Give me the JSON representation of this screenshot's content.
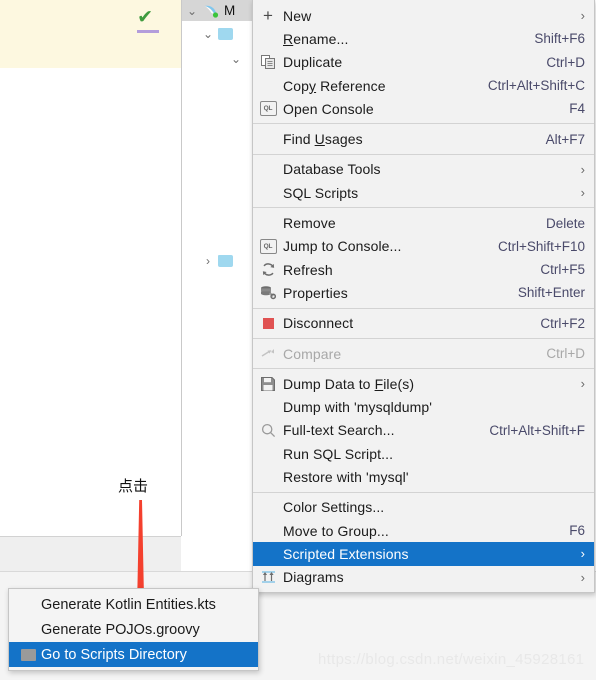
{
  "background": {
    "tree": {
      "root_label": "M",
      "root_icon": "mysql-dolphin-icon",
      "status_icon": "green-check-icon",
      "nodes": [
        {
          "chevron": "down",
          "icon": "folder-icon"
        },
        {
          "chevron": "down",
          "icon": "folder-icon"
        },
        {
          "chevron": "right",
          "icon": "folder-icon"
        }
      ]
    }
  },
  "annotation": {
    "label": "点击",
    "arrow_color": "#f4402e"
  },
  "context_menu": {
    "groups": [
      {
        "items": [
          {
            "label": "New",
            "accel": "",
            "icon": "plus-icon",
            "submenu": true,
            "disabled": false,
            "selected": false,
            "mnemonic": ""
          },
          {
            "label": "Rename...",
            "accel": "Shift+F6",
            "icon": "",
            "submenu": false,
            "disabled": false,
            "selected": false,
            "mnemonic": "R"
          },
          {
            "label": "Duplicate",
            "accel": "Ctrl+D",
            "icon": "duplicate-icon",
            "submenu": false,
            "disabled": false,
            "selected": false,
            "mnemonic": ""
          },
          {
            "label": "Copy Reference",
            "accel": "Ctrl+Alt+Shift+C",
            "icon": "",
            "submenu": false,
            "disabled": false,
            "selected": false,
            "mnemonic": "y"
          },
          {
            "label": "Open Console",
            "accel": "F4",
            "icon": "ql-console-icon",
            "submenu": false,
            "disabled": false,
            "selected": false,
            "mnemonic": ""
          }
        ]
      },
      {
        "items": [
          {
            "label": "Find Usages",
            "accel": "Alt+F7",
            "icon": "",
            "submenu": false,
            "disabled": false,
            "selected": false,
            "mnemonic": "U"
          }
        ]
      },
      {
        "items": [
          {
            "label": "Database Tools",
            "accel": "",
            "icon": "",
            "submenu": true,
            "disabled": false,
            "selected": false,
            "mnemonic": ""
          },
          {
            "label": "SQL Scripts",
            "accel": "",
            "icon": "",
            "submenu": true,
            "disabled": false,
            "selected": false,
            "mnemonic": ""
          }
        ]
      },
      {
        "items": [
          {
            "label": "Remove",
            "accel": "Delete",
            "icon": "",
            "submenu": false,
            "disabled": false,
            "selected": false,
            "mnemonic": ""
          },
          {
            "label": "Jump to Console...",
            "accel": "Ctrl+Shift+F10",
            "icon": "ql-console-icon",
            "submenu": false,
            "disabled": false,
            "selected": false,
            "mnemonic": ""
          },
          {
            "label": "Refresh",
            "accel": "Ctrl+F5",
            "icon": "refresh-icon",
            "submenu": false,
            "disabled": false,
            "selected": false,
            "mnemonic": ""
          },
          {
            "label": "Properties",
            "accel": "Shift+Enter",
            "icon": "properties-wrench-icon",
            "submenu": false,
            "disabled": false,
            "selected": false,
            "mnemonic": ""
          }
        ]
      },
      {
        "items": [
          {
            "label": "Disconnect",
            "accel": "Ctrl+F2",
            "icon": "stop-square-icon",
            "submenu": false,
            "disabled": false,
            "selected": false,
            "mnemonic": ""
          }
        ]
      },
      {
        "items": [
          {
            "label": "Compare",
            "accel": "Ctrl+D",
            "icon": "compare-arrows-icon",
            "submenu": false,
            "disabled": true,
            "selected": false,
            "mnemonic": ""
          }
        ]
      },
      {
        "items": [
          {
            "label": "Dump Data to File(s)",
            "accel": "",
            "icon": "save-floppy-icon",
            "submenu": true,
            "disabled": false,
            "selected": false,
            "mnemonic": "F"
          },
          {
            "label": "Dump with 'mysqldump'",
            "accel": "",
            "icon": "",
            "submenu": false,
            "disabled": false,
            "selected": false,
            "mnemonic": ""
          },
          {
            "label": "Full-text Search...",
            "accel": "Ctrl+Alt+Shift+F",
            "icon": "search-icon",
            "submenu": false,
            "disabled": false,
            "selected": false,
            "mnemonic": ""
          },
          {
            "label": "Run SQL Script...",
            "accel": "",
            "icon": "",
            "submenu": false,
            "disabled": false,
            "selected": false,
            "mnemonic": ""
          },
          {
            "label": "Restore with 'mysql'",
            "accel": "",
            "icon": "",
            "submenu": false,
            "disabled": false,
            "selected": false,
            "mnemonic": ""
          }
        ]
      },
      {
        "items": [
          {
            "label": "Color Settings...",
            "accel": "",
            "icon": "",
            "submenu": false,
            "disabled": false,
            "selected": false,
            "mnemonic": ""
          },
          {
            "label": "Move to Group...",
            "accel": "F6",
            "icon": "",
            "submenu": false,
            "disabled": false,
            "selected": false,
            "mnemonic": ""
          },
          {
            "label": "Scripted Extensions",
            "accel": "",
            "icon": "",
            "submenu": true,
            "disabled": false,
            "selected": true,
            "mnemonic": ""
          },
          {
            "label": "Diagrams",
            "accel": "",
            "icon": "diagrams-icon",
            "submenu": true,
            "disabled": false,
            "selected": false,
            "mnemonic": ""
          }
        ]
      }
    ]
  },
  "submenu": {
    "items": [
      {
        "label": "Generate Kotlin Entities.kts",
        "icon": "",
        "selected": false
      },
      {
        "label": "Generate POJOs.groovy",
        "icon": "",
        "selected": false
      },
      {
        "label": "Go to Scripts Directory",
        "icon": "folder-icon",
        "selected": true
      }
    ]
  },
  "watermark": {
    "text": "https://blog.csdn.net/weixin_45928161"
  },
  "colors": {
    "selection": "#1473c8",
    "menu_bg": "#f2f2f2",
    "accent_red": "#e05252"
  }
}
